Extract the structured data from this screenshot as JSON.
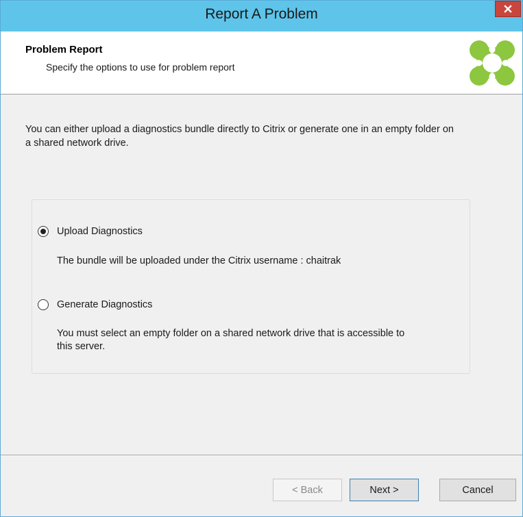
{
  "window": {
    "title": "Report A Problem",
    "close_icon": "close-x-icon"
  },
  "header": {
    "title": "Problem Report",
    "subtitle": "Specify the options to use for problem report",
    "logo_icon": "citrix-logo-icon",
    "logo_color": "#8dc63f"
  },
  "intro": {
    "line1": "You can either upload a diagnostics bundle directly to Citrix or generate one in an empty folder on",
    "line2": "a shared network drive."
  },
  "options": [
    {
      "label": "Upload Diagnostics",
      "selected": true,
      "description": "The bundle will be uploaded under the Citrix username : chaitrak"
    },
    {
      "label": "Generate Diagnostics",
      "selected": false,
      "description_line1": "You must select an empty folder on a shared network drive that is accessible to",
      "description_line2": "this server."
    }
  ],
  "buttons": {
    "back": "< Back",
    "next": "Next >",
    "cancel": "Cancel",
    "back_enabled": false
  },
  "colors": {
    "titlebar": "#5ec4ea",
    "close": "#c9463d"
  }
}
